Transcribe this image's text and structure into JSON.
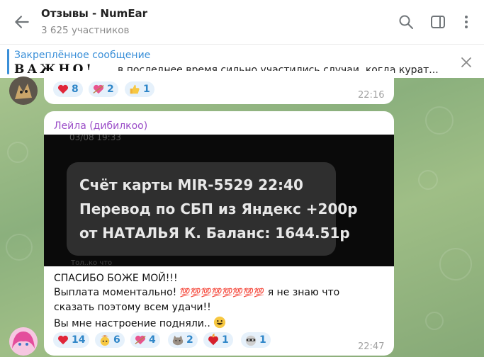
{
  "header": {
    "title": "Отзывы - NumEar",
    "subtitle": "3 625 участников"
  },
  "pinned": {
    "label": "Закреплённое сообщение",
    "image_text": "ВАЖНО!",
    "text": "в последнее время сильно участились случаи, когда курат..."
  },
  "message1": {
    "reactions": [
      {
        "icon": "red-heart-icon",
        "count": "8"
      },
      {
        "icon": "heart-arrow-icon",
        "count": "2"
      },
      {
        "icon": "thumbs-up-icon",
        "count": "1"
      }
    ],
    "time": "22:16"
  },
  "message2": {
    "sender": "Лейла (дибилкоо)",
    "photo": {
      "date": "03/08 19:33",
      "line1": "Счёт карты MIR-5529 22:40",
      "line2": "Перевод по СБП из Яндекс +200р",
      "line3": "от НАТАЛЬЯ К. Баланс: 1644.51р",
      "footer": "Тол..ко что"
    },
    "text_line1": "СПАСИБО БОЖЕ МОЙ!!!",
    "text_line2_start": "Выплата моментально!",
    "text_line2_emoji": "💯💯💯💯💯💯💯💯",
    "text_line2_end": "я не знаю что",
    "text_line3": "сказать поэтому всем удачи!!",
    "text_line4": "Вы мне настроение подняли..",
    "reactions": [
      {
        "icon": "red-heart-icon",
        "count": "14"
      },
      {
        "icon": "exploding-head-icon",
        "count": "6"
      },
      {
        "icon": "heart-arrow-icon",
        "count": "4"
      },
      {
        "icon": "cat-sticker-icon",
        "count": "2"
      },
      {
        "icon": "heart-fire-icon",
        "count": "1"
      },
      {
        "icon": "raccoon-sticker-icon",
        "count": "1"
      }
    ],
    "time": "22:47"
  },
  "colors": {
    "accent": "#3a8fd8",
    "sender": "#9b4ec8",
    "reaction_bg": "#e6f1fb",
    "heart": "#e0263a"
  }
}
